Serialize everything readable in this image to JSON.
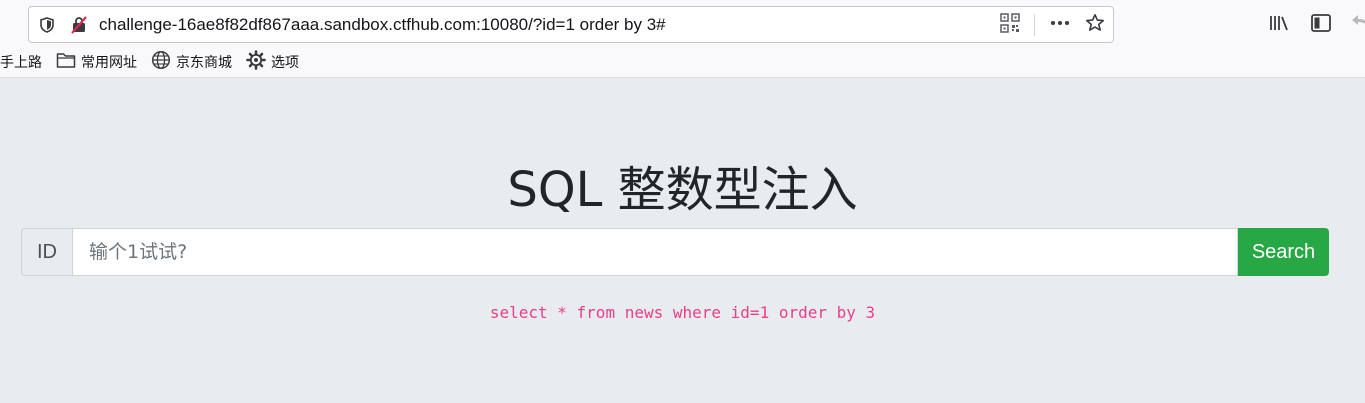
{
  "browser": {
    "url": "challenge-16ae8f82df867aaa.sandbox.ctfhub.com:10080/?id=1 order by 3#",
    "icons": [
      "shield-icon",
      "insecure-connection-icon",
      "qr-code-icon",
      "more-icon",
      "star-icon",
      "library-icon",
      "sidebar-icon",
      "back-icon"
    ]
  },
  "bookmarks": [
    {
      "label": "手上路",
      "icon": ""
    },
    {
      "label": "常用网址",
      "icon": "folder-icon"
    },
    {
      "label": "京东商城",
      "icon": "globe-icon"
    },
    {
      "label": "选项",
      "icon": "gear-icon"
    }
  ],
  "page": {
    "title": "SQL 整数型注入",
    "prefix_label": "ID",
    "input_placeholder": "输个1试试?",
    "input_value": "",
    "search_label": "Search",
    "query": "select * from news where id=1 order by 3"
  },
  "colors": {
    "background": "#e9ecef",
    "button": "#28a745",
    "query": "#e83e8c"
  }
}
